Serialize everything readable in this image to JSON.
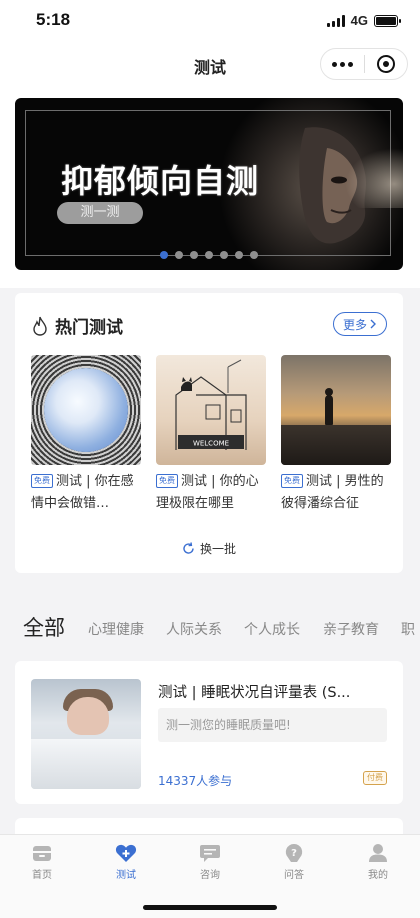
{
  "status_bar": {
    "time": "5:18",
    "network": "4G"
  },
  "nav": {
    "title": "测试"
  },
  "banner": {
    "title": "抑郁倾向自测",
    "button_label": "测一测",
    "dot_count": 7,
    "active_dot": 0
  },
  "hot": {
    "title": "热门测试",
    "more_label": "更多",
    "refresh_label": "换一批",
    "items": [
      {
        "tag": "免费",
        "text": "测试 | 你在感情中会做错…"
      },
      {
        "tag": "免费",
        "text": "测试 | 你的心理极限在哪里"
      },
      {
        "tag": "免费",
        "text": "测试 | 男性的彼得潘综合征"
      }
    ],
    "thumb2_sign": "WELCOME"
  },
  "categories": {
    "all": "全部",
    "items": [
      "心理健康",
      "人际关系",
      "个人成长",
      "亲子教育",
      "职"
    ]
  },
  "test_card": {
    "title": "测试 | 睡眠状况自评量表 (S...",
    "desc": "测一测您的睡眠质量吧!",
    "count": "14337人参与",
    "tag": "付费"
  },
  "tabs": [
    {
      "label": "首页",
      "icon": "home-icon"
    },
    {
      "label": "测试",
      "icon": "test-heart-icon"
    },
    {
      "label": "咨询",
      "icon": "chat-icon"
    },
    {
      "label": "问答",
      "icon": "question-icon"
    },
    {
      "label": "我的",
      "icon": "profile-icon"
    }
  ],
  "colors": {
    "accent": "#3b6fd1",
    "paid": "#d4a24c",
    "background": "#f3f3f5"
  }
}
